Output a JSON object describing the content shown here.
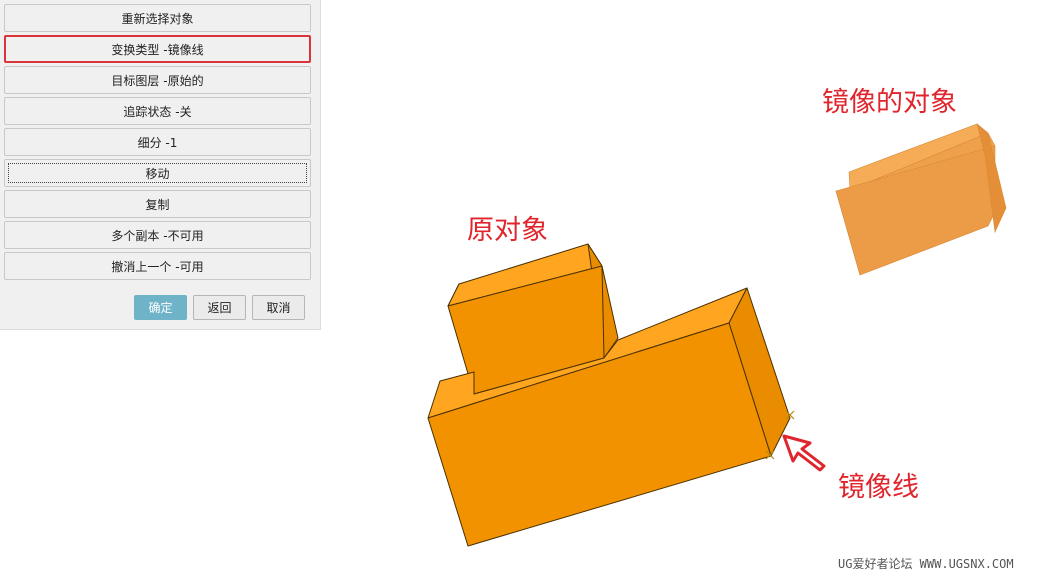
{
  "dialog": {
    "menu": [
      {
        "label": "重新选择对象",
        "name": "reselect-objects-button"
      },
      {
        "label": "变换类型 -镜像线",
        "name": "transform-type-mirror-line-button",
        "selected": true
      },
      {
        "label": "目标图层 -原始的",
        "name": "target-layer-original-button"
      },
      {
        "label": "追踪状态 -关",
        "name": "trace-status-off-button"
      },
      {
        "label": "细分 -1",
        "name": "subdivide-button"
      },
      {
        "label": "移动",
        "name": "move-button",
        "focused": true
      },
      {
        "label": "复制",
        "name": "copy-button"
      },
      {
        "label": "多个副本 -不可用",
        "name": "multiple-copies-button"
      },
      {
        "label": "撤消上一个 -可用",
        "name": "undo-last-button"
      }
    ],
    "ok_label": "确定",
    "back_label": "返回",
    "cancel_label": "取消"
  },
  "annotations": {
    "mirrored_object": "镜像的对象",
    "original_object": "原对象",
    "mirror_line": "镜像线"
  },
  "colors": {
    "annotation": "#e0252d",
    "solid_front": "#f39200",
    "solid_top": "#ffa51f",
    "solid_side": "#e98c00",
    "mirror_front": "#f0a04a",
    "ok_button": "#6fb3c9"
  },
  "watermark": "UG爱好者论坛 WWW.UGSNX.COM"
}
